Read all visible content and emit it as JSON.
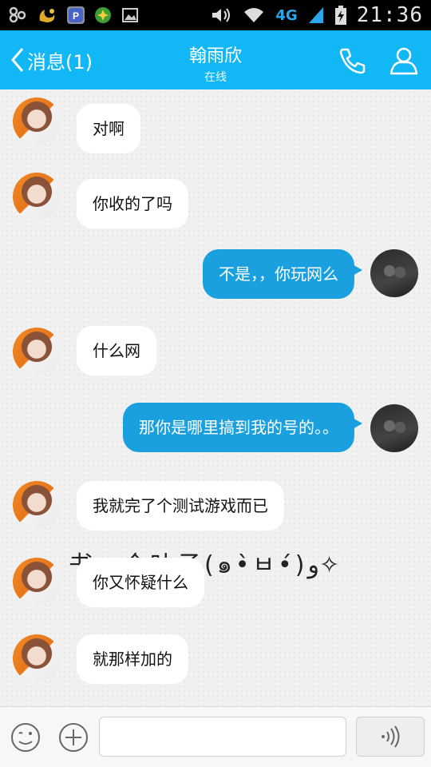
{
  "status_bar": {
    "network": "4G",
    "time": "21:36",
    "icons": [
      "app-8-icon",
      "weather-icon",
      "paypal-icon",
      "game-icon",
      "image-icon",
      "volume-icon",
      "wifi-icon",
      "signal-icon",
      "battery-icon"
    ]
  },
  "header": {
    "back_label": "消息(1)",
    "contact_name": "翰雨欣",
    "contact_status": "在线",
    "background": "#12b7f5"
  },
  "messages": [
    {
      "sender": "her",
      "text": "对啊"
    },
    {
      "sender": "her",
      "text": "你收的了吗"
    },
    {
      "sender": "me",
      "text": "不是，，你玩网么"
    },
    {
      "sender": "her",
      "text": "什么网"
    },
    {
      "sender": "me",
      "text": "那你是哪里搞到我的号的。。"
    },
    {
      "sender": "her",
      "text": "我就完了个测试游戏而已"
    },
    {
      "sender": "her",
      "text": "你又怀疑什么"
    },
    {
      "sender": "her",
      "text": "就那样加的"
    }
  ],
  "overlay_text": "书一个叶子(๑•̀ㅂ•́)و✧",
  "input": {
    "value": "",
    "placeholder": ""
  },
  "colors": {
    "my_bubble": "#1aa0df",
    "her_bubble": "#ffffff",
    "accent": "#12b7f5"
  }
}
